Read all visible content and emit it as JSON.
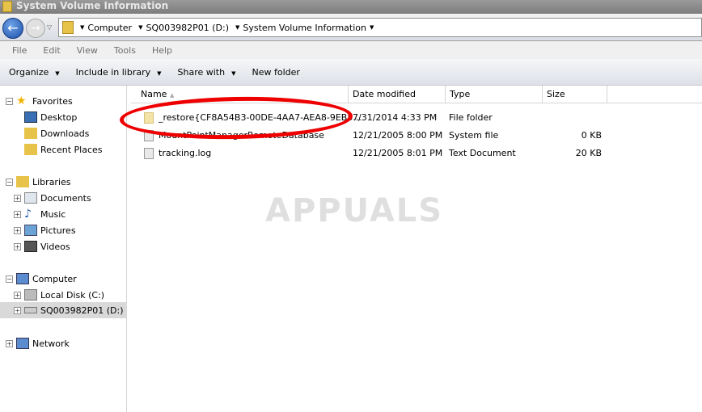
{
  "window": {
    "title": "System Volume Information"
  },
  "address": {
    "crumbs": [
      "Computer",
      "SQ003982P01 (D:)",
      "System Volume Information"
    ]
  },
  "menu": [
    "File",
    "Edit",
    "View",
    "Tools",
    "Help"
  ],
  "toolbar": {
    "organize": "Organize",
    "include": "Include in library",
    "share": "Share with",
    "new_folder": "New folder"
  },
  "nav": {
    "favorites": "Favorites",
    "desktop": "Desktop",
    "downloads": "Downloads",
    "recent": "Recent Places",
    "libraries": "Libraries",
    "documents": "Documents",
    "music": "Music",
    "pictures": "Pictures",
    "videos": "Videos",
    "computer": "Computer",
    "local_disk": "Local Disk (C:)",
    "drive_d": "SQ003982P01 (D:)",
    "network": "Network"
  },
  "columns": {
    "name": "Name",
    "date": "Date modified",
    "type": "Type",
    "size": "Size"
  },
  "files": [
    {
      "name": "_restore{CF8A54B3-00DE-4AA7-AEA8-9EB5...",
      "date": "7/31/2014 4:33 PM",
      "type": "File folder",
      "size": ""
    },
    {
      "name": "MountPointManagerRemoteDatabase",
      "date": "12/21/2005 8:00 PM",
      "type": "System file",
      "size": "0 KB"
    },
    {
      "name": "tracking.log",
      "date": "12/21/2005 8:01 PM",
      "type": "Text Document",
      "size": "20 KB"
    }
  ],
  "watermark": "APPUALS"
}
